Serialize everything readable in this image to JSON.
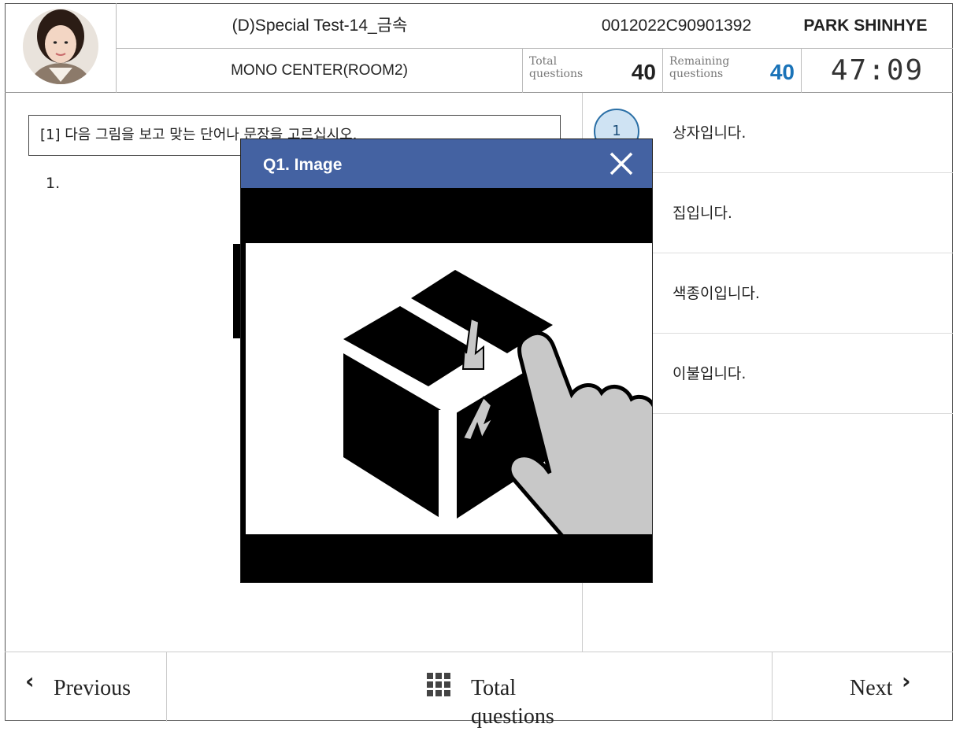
{
  "header": {
    "exam_title": "(D)Special Test-14_금속",
    "examinee_id": "0012022C90901392",
    "examinee_name": "PARK SHINHYE",
    "center": "MONO CENTER(ROOM2)",
    "total_questions_label": "Total questions",
    "total_questions_value": "40",
    "remaining_questions_label": "Remaining questions",
    "remaining_questions_value": "40",
    "remaining_color": "#1a73b8",
    "timer": "47:09"
  },
  "question": {
    "instruction": "[1] 다음 그림을 보고 맞는 단어나 문장을 고르십시오.",
    "number": "1."
  },
  "options": [
    {
      "number": "1",
      "text": "상자입니다."
    },
    {
      "text": "집입니다."
    },
    {
      "text": "색종이입니다."
    },
    {
      "text": "이불입니다."
    }
  ],
  "footer": {
    "previous_label": "Previous",
    "total_questions_label": "Total questions",
    "next_label": "Next"
  },
  "modal": {
    "title": "Q1. Image",
    "header_color": "#4462a2",
    "image_icon": "box-with-hand-press-icon"
  }
}
